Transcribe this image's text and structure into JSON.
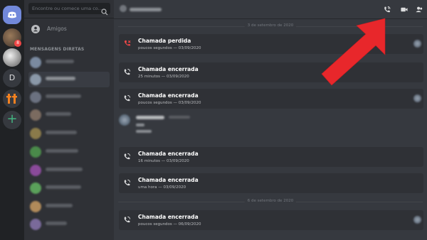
{
  "search": {
    "placeholder": "Encontre ou comece uma co..."
  },
  "friends_label": "Amigos",
  "dm_header": "MENSAGENS DIRETAS",
  "servers": {
    "dm_badge": "8",
    "letter_server": "D",
    "add": "+"
  },
  "date_separators": [
    "3 de setembro de 2020",
    "6 de setembro de 2020"
  ],
  "calls": [
    {
      "title": "Chamada perdida",
      "subtitle": "poucos segundos — 03/09/2020",
      "type": "missed"
    },
    {
      "title": "Chamada encerrada",
      "subtitle": "25 minutos — 03/09/2020",
      "type": "ended"
    },
    {
      "title": "Chamada encerrada",
      "subtitle": "poucos segundos — 03/09/2020",
      "type": "ended"
    },
    {
      "title": "Chamada encerrada",
      "subtitle": "16 minutos — 03/09/2020",
      "type": "ended"
    },
    {
      "title": "Chamada encerrada",
      "subtitle": "uma hora — 03/09/2020",
      "type": "ended"
    },
    {
      "title": "Chamada encerrada",
      "subtitle": "poucos segundos — 06/09/2020",
      "type": "ended"
    }
  ],
  "topbar_icons": [
    "voice-call-icon",
    "video-call-icon",
    "add-member-icon"
  ],
  "colors": {
    "accent": "#7289da",
    "missed": "#f04747",
    "arrow": "#e8272b",
    "online": "#43b581"
  }
}
